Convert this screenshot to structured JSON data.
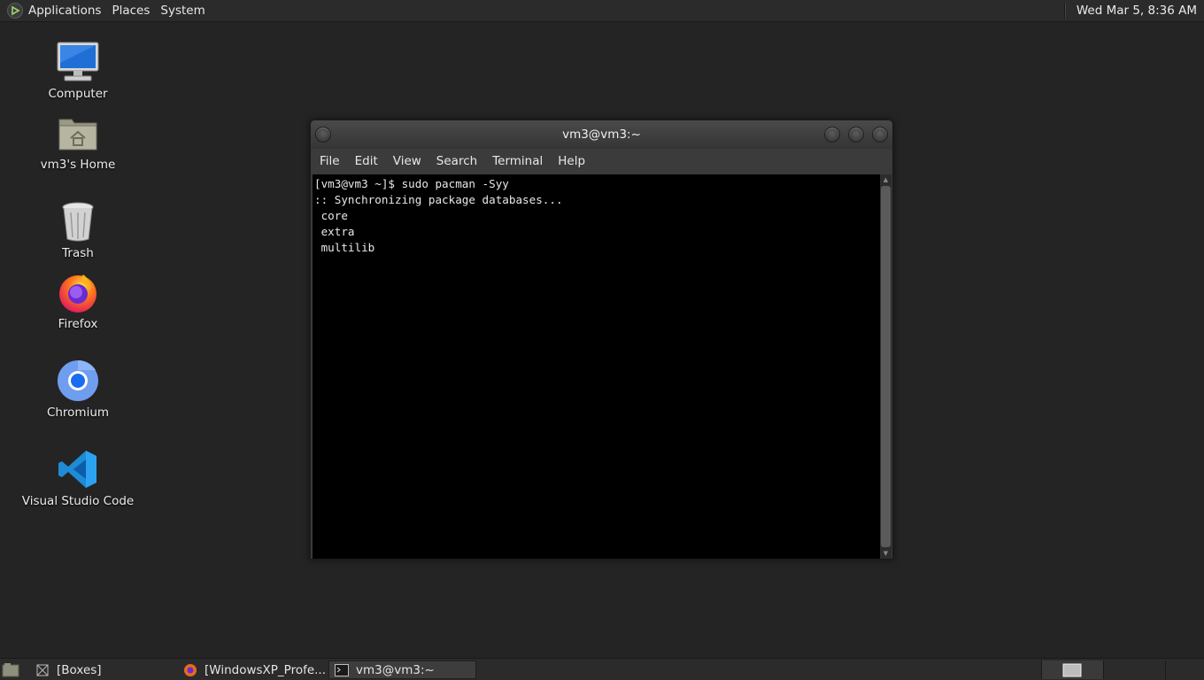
{
  "top_panel": {
    "menus": [
      "Applications",
      "Places",
      "System"
    ],
    "clock": "Wed Mar  5,  8:36 AM"
  },
  "desktop": {
    "icons": [
      {
        "label": "Computer",
        "icon": "computer-icon"
      },
      {
        "label": "vm3's Home",
        "icon": "home-folder-icon"
      },
      {
        "label": "Trash",
        "icon": "trash-icon"
      },
      {
        "label": "Firefox",
        "icon": "firefox-icon"
      },
      {
        "label": "Chromium",
        "icon": "chromium-icon"
      },
      {
        "label": "Visual Studio Code",
        "icon": "vscode-icon"
      }
    ]
  },
  "terminal": {
    "title": "vm3@vm3:~",
    "menu": [
      "File",
      "Edit",
      "View",
      "Search",
      "Terminal",
      "Help"
    ],
    "lines": [
      "[vm3@vm3 ~]$ sudo pacman -Syy",
      ":: Synchronizing package databases...",
      " core",
      " extra",
      " multilib"
    ]
  },
  "taskbar": {
    "tasks": [
      {
        "label": "[Boxes]",
        "icon": "boxes-icon"
      },
      {
        "label": "[WindowsXP_Profe...",
        "icon": "firefox-icon"
      },
      {
        "label": "vm3@vm3:~",
        "icon": "terminal-icon",
        "active": true
      }
    ]
  },
  "colors": {
    "desktop_bg": "#242424",
    "panel_bg": "#2b2b2b",
    "terminal_bg": "#000000",
    "terminal_fg": "#e8e8e8"
  }
}
